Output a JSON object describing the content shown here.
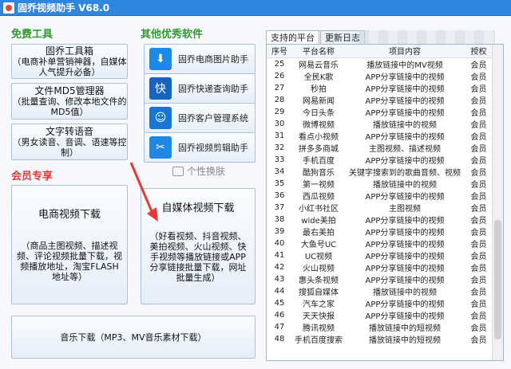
{
  "window": {
    "title": "固乔视频助手 V68.0"
  },
  "sections": {
    "free_tools": "免费工具",
    "other_software": "其他优秀软件",
    "member": "会员专享"
  },
  "free_buttons": [
    {
      "line1": "固乔工具箱",
      "line2": "（电商补单营销神器，自媒体人气提升必备）"
    },
    {
      "line1": "文件MD5管理器",
      "line2": "（批量查询、修改本地文件的MD5值）"
    },
    {
      "line1": "文字转语音",
      "line2": "（男女读音、音调、语速等控制）"
    }
  ],
  "software_items": [
    {
      "label": "固乔电商图片助手",
      "icon": "download-icon"
    },
    {
      "label": "固乔快递查询助手",
      "icon": "express-icon"
    },
    {
      "label": "固乔客户管理系统",
      "icon": "person-icon"
    },
    {
      "label": "固乔视频剪辑助手",
      "icon": "scissors-icon"
    }
  ],
  "skin_label": "个性换肤",
  "member_buttons": {
    "ecommerce": {
      "title": "电商视频下载",
      "desc": "（商品主图视频、描述视频、评论视频批量下载，视频播放地址，淘宝FLASH地址等）"
    },
    "media": {
      "title": "自媒体视频下载",
      "desc": "（好看视频、抖音视频、美拍视频、火山视频、快手视频等播放链接或APP分享链接批量下载，网址批量生成）"
    },
    "music": {
      "title": "音乐下载（MP3、MV音乐素材下载）"
    }
  },
  "tabs": [
    "支持的平台",
    "更新日志"
  ],
  "table": {
    "headers": [
      "序号",
      "平台名称",
      "项目内容",
      "授权"
    ],
    "rows": [
      [
        "25",
        "网易云音乐",
        "播放链接中的MV视频",
        "会员"
      ],
      [
        "26",
        "全民K歌",
        "APP分享链接中的视频",
        "会员"
      ],
      [
        "27",
        "秒拍",
        "APP分享链接中的视频",
        "会员"
      ],
      [
        "28",
        "网易新闻",
        "APP分享链接中的视频",
        "会员"
      ],
      [
        "29",
        "今日头条",
        "APP分享链接中的视频",
        "会员"
      ],
      [
        "30",
        "微博视频",
        "播放链接中的视频",
        "会员"
      ],
      [
        "31",
        "看点小视频",
        "APP分享链接中的视频",
        "会员"
      ],
      [
        "32",
        "拼多多商城",
        "主图视频、描述视频",
        "会员"
      ],
      [
        "33",
        "手机百度",
        "APP分享链接中的视频",
        "会员"
      ],
      [
        "34",
        "酷狗音乐",
        "关键字搜索到的歌曲音频、视频",
        "会员"
      ],
      [
        "35",
        "第一视频",
        "播放链接中的视频",
        "会员"
      ],
      [
        "36",
        "西瓜视频",
        "APP分享链接中的视频",
        "会员"
      ],
      [
        "37",
        "小红书社区",
        "主图视频",
        "会员"
      ],
      [
        "38",
        "wide美拍",
        "APP分享链接中的视频",
        "会员"
      ],
      [
        "39",
        "最右美拍",
        "APP分享链接中的视频",
        "会员"
      ],
      [
        "40",
        "大鱼号UC",
        "APP分享链接中的视频",
        "会员"
      ],
      [
        "41",
        "UC视频",
        "APP分享链接中的视频",
        "会员"
      ],
      [
        "42",
        "火山视频",
        "APP分享链接中的视频",
        "会员"
      ],
      [
        "43",
        "惠头条视频",
        "APP分享链接中的视频",
        "会员"
      ],
      [
        "44",
        "搜狐自媒体",
        "播放链接中的视频",
        "会员"
      ],
      [
        "45",
        "汽车之家",
        "APP分享链接中的视频",
        "会员"
      ],
      [
        "46",
        "天天快报",
        "APP分享链接中的视频",
        "会员"
      ],
      [
        "47",
        "腾讯视频",
        "播放链接中的短视频",
        "会员"
      ],
      [
        "48",
        "手机百度搜索",
        "播放链接中的短视频",
        "会员"
      ]
    ]
  },
  "colors": {
    "titlebar": "#2e86de",
    "accent_green": "#2e9b2e",
    "accent_red": "#e53935",
    "arrow": "#e53935"
  }
}
